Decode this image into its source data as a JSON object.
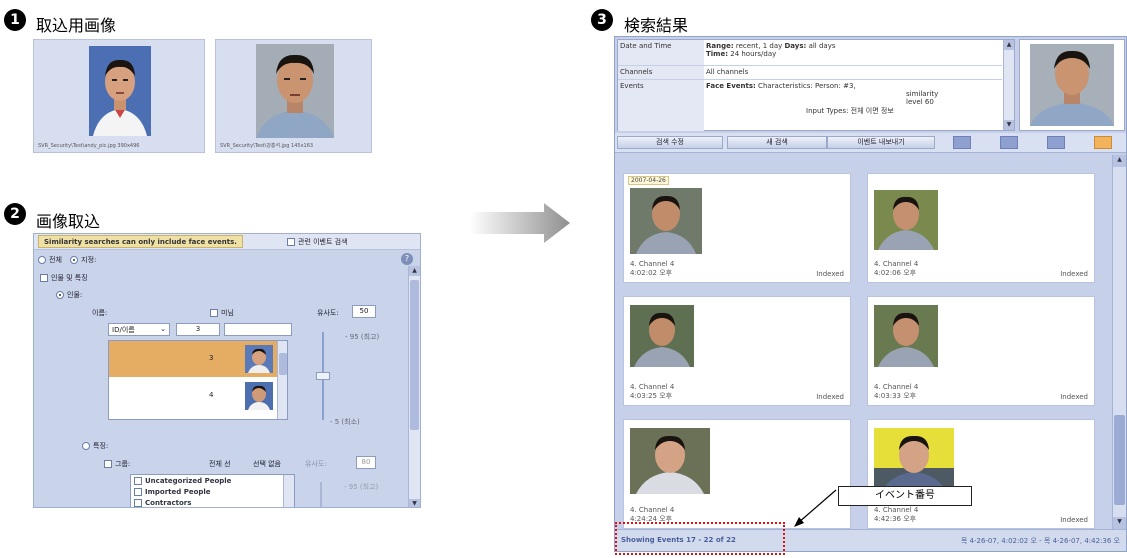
{
  "step1": {
    "number": "1",
    "title": "取込用画像",
    "images": [
      {
        "caption": "SVR_Security\\Test\\andy_pic.jpg    390x496"
      },
      {
        "caption": "SVR_Security\\Test\\강홍석.jpg    145x163"
      }
    ]
  },
  "step2": {
    "number": "2",
    "title": "画像取込",
    "warning": "Similarity searches can only include face events.",
    "related_search": "관련 이벤트 검색",
    "scope_all": "전체",
    "scope_specify": "지정:",
    "person_features": "인물 및 특징",
    "person": "인물:",
    "name_label": "이름:",
    "none_label": "미님",
    "similarity_label": "유사도:",
    "similarity_value": "50",
    "id_select": "ID/이름",
    "id_value": "3",
    "max_label": "- 95 (최고)",
    "min_label": "- 5 (최소)",
    "list": [
      {
        "id": "3"
      },
      {
        "id": "4"
      }
    ],
    "features": "특징:",
    "group": "그룹:",
    "select_all": "전체 선",
    "select_none": "선택 없음",
    "similarity2": "유사도:",
    "similarity2_value": "80",
    "max2": "- 95 (최고)",
    "groups": [
      "Uncategorized People",
      "Imported People",
      "Contractors"
    ]
  },
  "step3": {
    "number": "3",
    "title": "検索結果",
    "info": [
      {
        "label": "Date and Time",
        "value_bold": "Range:",
        "value": " recent, 1 day  ",
        "value_bold2": "Days:",
        "value2": " all days",
        "line2_bold": "Time:",
        "line2": " 24 hours/day"
      },
      {
        "label": "Channels",
        "value": "All channels"
      },
      {
        "label": "Events",
        "value_bold": "Face Events:",
        "value": " Characteristics:  Person:  #3,",
        "line2": "similarity",
        "line3": "level 60",
        "line4": "Input Types:  전체 이면 정보"
      }
    ],
    "toolbar": {
      "btn1": "검색 수정",
      "btn2": "새 검색",
      "btn3": "이벤트 내보내기"
    },
    "date_tag": "2007-04-26",
    "cards": [
      {
        "channel": "4. Channel 4",
        "time": "4:02:02 오후",
        "status": "Indexed"
      },
      {
        "channel": "4. Channel 4",
        "time": "4:02:06 오후",
        "status": "Indexed"
      },
      {
        "channel": "4. Channel 4",
        "time": "4:03:25 오후",
        "status": "Indexed"
      },
      {
        "channel": "4. Channel 4",
        "time": "4:03:33 오후",
        "status": "Indexed"
      },
      {
        "channel": "4. Channel 4",
        "time": "4:24:24 오후",
        "status": "Indexed"
      },
      {
        "channel": "4. Channel 4",
        "time": "4:42:36 오후",
        "status": "Indexed"
      }
    ],
    "status_left": "Showing Events 17 - 22 of 22",
    "status_right": "목 4-26-07, 4:02:02 오 - 목 4-26-07, 4:42:36 오",
    "callout": "イベント番号"
  }
}
